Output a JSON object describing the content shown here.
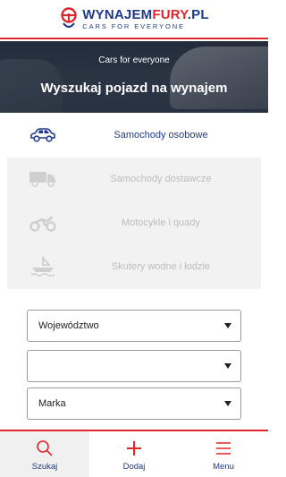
{
  "brand": {
    "title_prefix": "WYNAJEM",
    "title_accent": "FURY",
    "title_suffix": ".PL",
    "tagline": "CARS FOR EVERYONE",
    "colors": {
      "blue": "#1f3a8a",
      "red": "#e0262b"
    }
  },
  "hero": {
    "subtitle": "Cars for everyone",
    "title": "Wyszukaj pojazd na wynajem"
  },
  "categories": [
    {
      "label": "Samochody osobowe",
      "icon": "car-icon",
      "active": true
    },
    {
      "label": "Samochody dostawcze",
      "icon": "van-icon",
      "active": false
    },
    {
      "label": "Motocykle i quady",
      "icon": "motorcycle-icon",
      "active": false
    },
    {
      "label": "Skutery wodne i łodzie",
      "icon": "boat-icon",
      "active": false
    }
  ],
  "form": {
    "voivodeship": "Województwo",
    "city": "",
    "brand": "Marka"
  },
  "bottom_nav": [
    {
      "label": "Szukaj",
      "icon": "search-icon",
      "active": true
    },
    {
      "label": "Dodaj",
      "icon": "plus-icon",
      "active": false
    },
    {
      "label": "Menu",
      "icon": "menu-icon",
      "active": false
    }
  ]
}
